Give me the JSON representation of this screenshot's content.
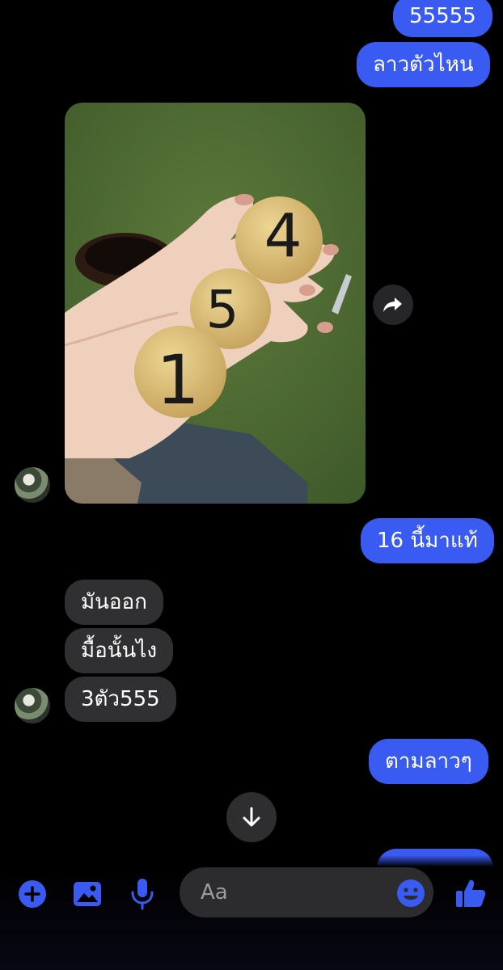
{
  "messages": {
    "sent_1": "55555",
    "sent_2": "ลาวตัวไหน",
    "sent_3": "16 นี้มาแท้",
    "recv_1": "มันออก",
    "recv_2": "มื้อนั้นไง",
    "recv_3": "3ตัว555",
    "sent_4": "ตามลาวๆ",
    "sent_5": ""
  },
  "photo": {
    "ball_numbers": [
      "4",
      "5",
      "1"
    ]
  },
  "composer": {
    "placeholder": "Aa",
    "icons": [
      "plus-icon",
      "image-icon",
      "microphone-icon",
      "emoji-icon",
      "thumbs-up-icon"
    ]
  },
  "colors": {
    "accent": "#3a5bf2",
    "incoming": "#303033",
    "background": "#000000"
  }
}
